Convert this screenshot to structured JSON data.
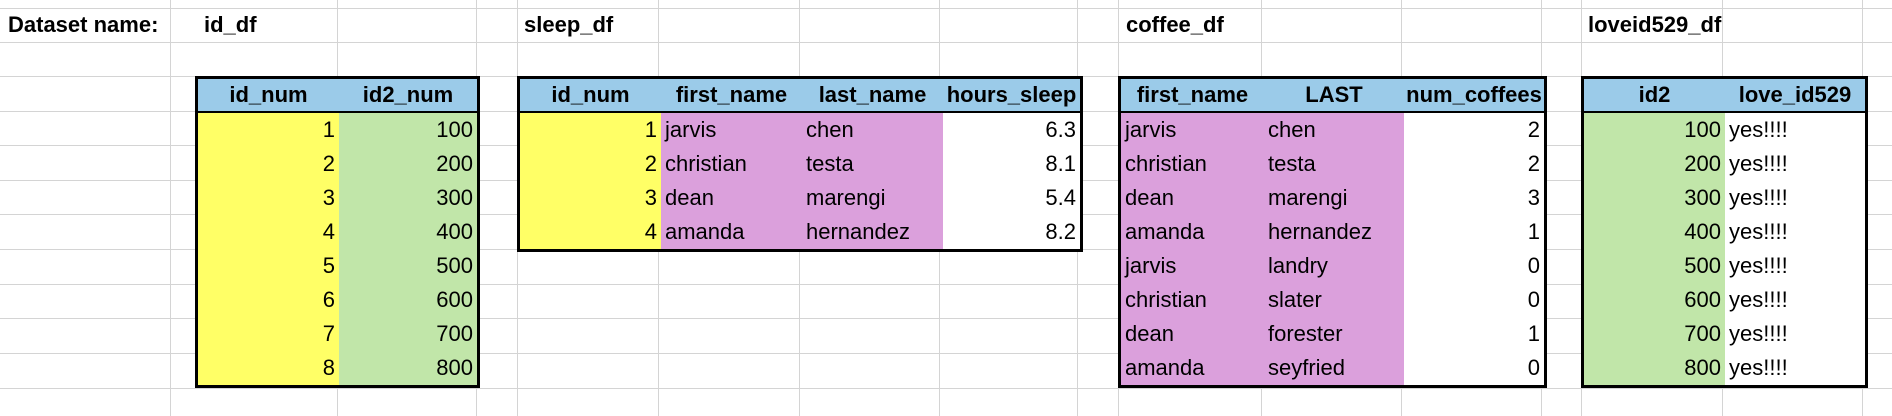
{
  "dataset_label": "Dataset name:",
  "colors": {
    "header": "#9bcbe9",
    "id_fill": "#ffff66",
    "id2_fill": "#c1e6a9",
    "name_fill": "#dba0dc"
  },
  "tables": [
    {
      "name": "id_df",
      "headers": [
        "id_num",
        "id2_num"
      ],
      "rows": [
        [
          "1",
          "100"
        ],
        [
          "2",
          "200"
        ],
        [
          "3",
          "300"
        ],
        [
          "4",
          "400"
        ],
        [
          "5",
          "500"
        ],
        [
          "6",
          "600"
        ],
        [
          "7",
          "700"
        ],
        [
          "8",
          "800"
        ]
      ]
    },
    {
      "name": "sleep_df",
      "headers": [
        "id_num",
        "first_name",
        "last_name",
        "hours_sleep"
      ],
      "rows": [
        [
          "1",
          "jarvis",
          "chen",
          "6.3"
        ],
        [
          "2",
          "christian",
          "testa",
          "8.1"
        ],
        [
          "3",
          "dean",
          "marengi",
          "5.4"
        ],
        [
          "4",
          "amanda",
          "hernandez",
          "8.2"
        ]
      ]
    },
    {
      "name": "coffee_df",
      "headers": [
        "first_name",
        "LAST",
        "num_coffees"
      ],
      "rows": [
        [
          "jarvis",
          "chen",
          "2"
        ],
        [
          "christian",
          "testa",
          "2"
        ],
        [
          "dean",
          "marengi",
          "3"
        ],
        [
          "amanda",
          "hernandez",
          "1"
        ],
        [
          "jarvis",
          "landry",
          "0"
        ],
        [
          "christian",
          "slater",
          "0"
        ],
        [
          "dean",
          "forester",
          "1"
        ],
        [
          "amanda",
          "seyfried",
          "0"
        ]
      ]
    },
    {
      "name": "loveid529_df",
      "headers": [
        "id2",
        "love_id529"
      ],
      "rows": [
        [
          "100",
          "yes!!!!"
        ],
        [
          "200",
          "yes!!!!"
        ],
        [
          "300",
          "yes!!!!"
        ],
        [
          "400",
          "yes!!!!"
        ],
        [
          "500",
          "yes!!!!"
        ],
        [
          "600",
          "yes!!!!"
        ],
        [
          "700",
          "yes!!!!"
        ],
        [
          "800",
          "yes!!!!"
        ]
      ]
    }
  ]
}
